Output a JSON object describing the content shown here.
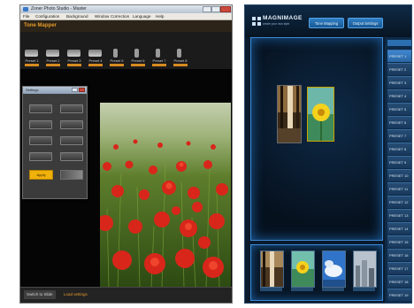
{
  "left_app": {
    "title": "Zoner Photo Studio - Master",
    "menu": [
      "File",
      "Configuration",
      "Background",
      "Window",
      "Correction",
      "Language",
      "Help"
    ],
    "header_title": "Tone Mapper",
    "presets": [
      {
        "label": "Preset 1"
      },
      {
        "label": "Preset 2"
      },
      {
        "label": "Preset 3"
      },
      {
        "label": "Preset 4"
      },
      {
        "label": "Preset 5"
      },
      {
        "label": "Preset 6"
      },
      {
        "label": "Preset 7"
      },
      {
        "label": "Preset 8"
      }
    ],
    "float_panel_title": "Settings",
    "orange_button": "Apply",
    "bottom_tabs": [
      "Switch to Slide",
      "Load settings"
    ]
  },
  "right_app": {
    "logo": "MAGNIMAGE",
    "logo_sub": "create your own style",
    "tabs": [
      "Tone Mapping",
      "Output Settings"
    ],
    "presets": [
      "PRESET 1",
      "PRESET 2",
      "PRESET 3",
      "PRESET 4",
      "PRESET 5",
      "PRESET 6",
      "PRESET 7",
      "PRESET 8",
      "PRESET 9",
      "PRESET 10",
      "PRESET 11",
      "PRESET 12",
      "PRESET 13",
      "PRESET 14",
      "PRESET 15",
      "PRESET 16",
      "PRESET 17",
      "PRESET 18",
      "PRESET 19"
    ]
  },
  "colors": {
    "orange": "#e39a2a",
    "accent_blue": "#3c8bd6",
    "dark_bg": "#0b1a2c"
  },
  "icons": [
    "app-icon",
    "minimize-icon",
    "maximize-icon",
    "close-icon",
    "pushpin-icon",
    "logo-icon"
  ]
}
